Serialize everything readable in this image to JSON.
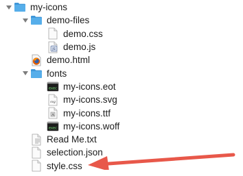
{
  "tree": {
    "rows": [
      {
        "label": "my-icons",
        "depth": 0,
        "disclosure": "open",
        "icon": "folder-icon"
      },
      {
        "label": "demo-files",
        "depth": 1,
        "disclosure": "open",
        "icon": "folder-icon"
      },
      {
        "label": "demo.css",
        "depth": 2,
        "disclosure": "none",
        "icon": "blank-document-icon"
      },
      {
        "label": "demo.js",
        "depth": 2,
        "disclosure": "none",
        "icon": "script-document-icon"
      },
      {
        "label": "demo.html",
        "depth": 1,
        "disclosure": "none",
        "icon": "firefox-document-icon"
      },
      {
        "label": "fonts",
        "depth": 1,
        "disclosure": "open",
        "icon": "folder-icon"
      },
      {
        "label": "my-icons.eot",
        "depth": 2,
        "disclosure": "none",
        "icon": "exec-document-icon"
      },
      {
        "label": "my-icons.svg",
        "depth": 2,
        "disclosure": "none",
        "icon": "svg-document-icon"
      },
      {
        "label": "my-icons.ttf",
        "depth": 2,
        "disclosure": "none",
        "icon": "font-document-icon"
      },
      {
        "label": "my-icons.woff",
        "depth": 2,
        "disclosure": "none",
        "icon": "exec-document-icon"
      },
      {
        "label": "Read Me.txt",
        "depth": 1,
        "disclosure": "none",
        "icon": "text-document-icon"
      },
      {
        "label": "selection.json",
        "depth": 1,
        "disclosure": "none",
        "icon": "blank-document-icon"
      },
      {
        "label": "style.css",
        "depth": 1,
        "disclosure": "none",
        "icon": "blank-document-icon"
      }
    ]
  },
  "annotation": {
    "icon": "red-arrow-icon",
    "color": "#e8584a"
  },
  "colors": {
    "folder": "#56aeea",
    "folder_tab": "#3f97d9",
    "disclosure": "#7d7d7d"
  }
}
